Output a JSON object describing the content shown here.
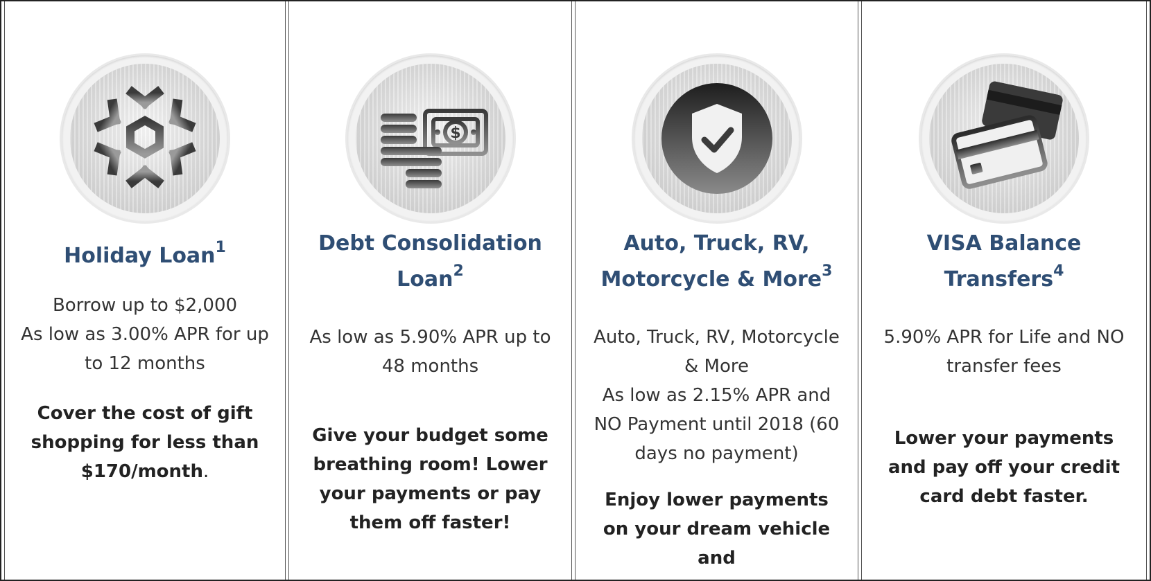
{
  "cards": [
    {
      "icon": "snowflake-icon",
      "title": "Holiday Loan",
      "footnote": "1",
      "details": [
        "Borrow up to $2,000",
        "As low as 3.00% APR for up to 12 months"
      ],
      "highlight_bold": "Cover the cost of gift shopping for less than $170/month",
      "highlight_tail": "."
    },
    {
      "icon": "money-coins-icon",
      "title": "Debt Consolidation Loan",
      "footnote": "2",
      "details": [
        "As low as 5.90% APR up to 48 months"
      ],
      "highlight_bold": "Give your budget some breathing room! Lower your payments or pay them off faster!"
    },
    {
      "icon": "shield-check-icon",
      "title": "Auto, Truck, RV, Motorcycle & More",
      "footnote": "3",
      "details": [
        "Auto, Truck, RV, Motorcycle & More",
        "As low as 2.15% APR and NO Payment until 2018 (60 days no payment)"
      ],
      "highlight_bold": "Enjoy lower payments on your dream vehicle and"
    },
    {
      "icon": "credit-cards-icon",
      "title": "VISA Balance Transfers",
      "footnote": "4",
      "details": [
        "5.90% APR for Life and NO transfer fees"
      ],
      "highlight_bold": "Lower your payments and pay off your credit card debt faster."
    }
  ],
  "colors": {
    "title": "#2f4e74",
    "body": "#333333",
    "border": "#222222"
  }
}
